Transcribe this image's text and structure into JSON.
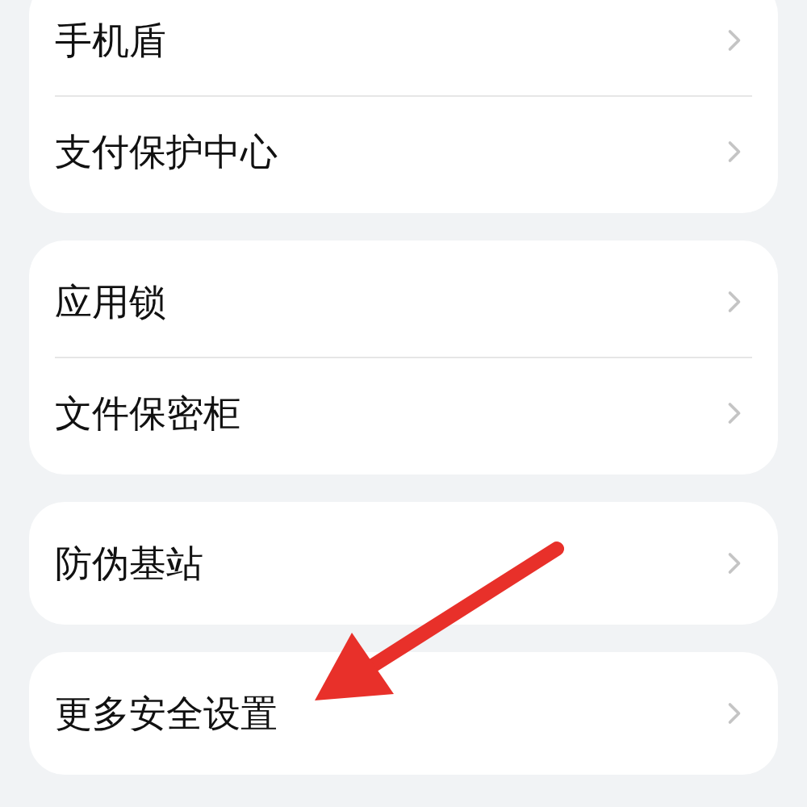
{
  "groups": [
    {
      "items": [
        {
          "label": "手机盾"
        },
        {
          "label": "支付保护中心"
        }
      ]
    },
    {
      "items": [
        {
          "label": "应用锁"
        },
        {
          "label": "文件保密柜"
        }
      ]
    },
    {
      "items": [
        {
          "label": "防伪基站"
        }
      ]
    },
    {
      "items": [
        {
          "label": "更多安全设置"
        }
      ]
    }
  ]
}
